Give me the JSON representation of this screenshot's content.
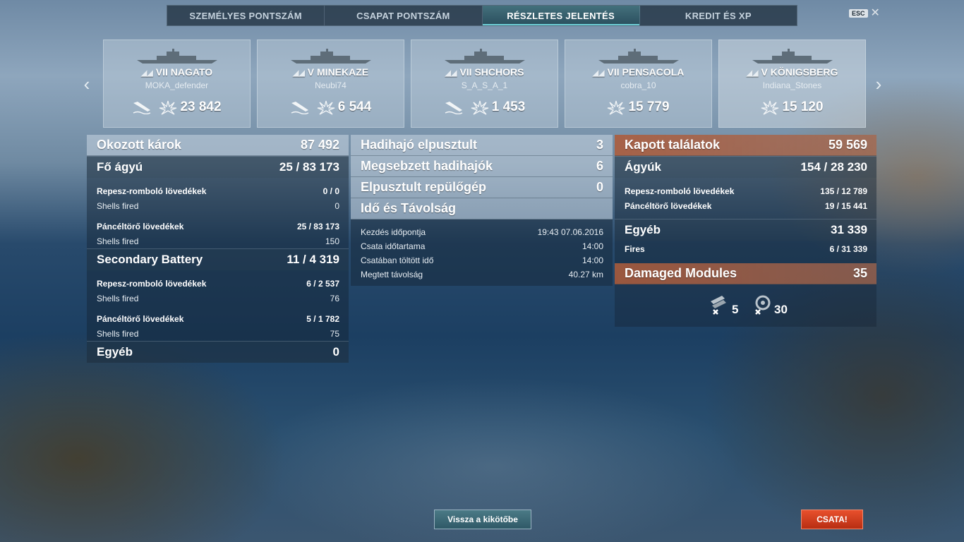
{
  "tabs": [
    "SZEMÉLYES PONTSZÁM",
    "CSAPAT PONTSZÁM",
    "RÉSZLETES JELENTÉS",
    "KREDIT ÉS XP"
  ],
  "active_tab": 2,
  "esc": {
    "key": "ESC",
    "close": "✕"
  },
  "carousel": {
    "prev": "‹",
    "next": "›"
  },
  "ships": [
    {
      "tier": "VII",
      "name": "NAGATO",
      "player": "MOKA_defender",
      "sunk": true,
      "damage": "23 842"
    },
    {
      "tier": "V",
      "name": "MINEKAZE",
      "player": "Neubi74",
      "sunk": true,
      "damage": "6 544"
    },
    {
      "tier": "VII",
      "name": "SHCHORS",
      "player": "S_A_S_A_1",
      "sunk": true,
      "damage": "1 453"
    },
    {
      "tier": "VII",
      "name": "PENSACOLA",
      "player": "cobra_10",
      "sunk": false,
      "damage": "15 779"
    },
    {
      "tier": "V",
      "name": "KÖNIGSBERG",
      "player": "Indiana_Stones",
      "sunk": false,
      "damage": "15 120"
    }
  ],
  "dealt": {
    "header": {
      "label": "Okozott károk",
      "value": "87 492"
    },
    "main": {
      "label": "Fő ágyú",
      "value": "25 / 83 173"
    },
    "main_he": {
      "label": "Repesz-romboló lövedékek",
      "value": "0 / 0"
    },
    "main_he_fired": {
      "label": "Shells fired",
      "value": "0"
    },
    "main_ap": {
      "label": "Páncéltörő lövedékek",
      "value": "25 / 83 173"
    },
    "main_ap_fired": {
      "label": "Shells fired",
      "value": "150"
    },
    "secondary": {
      "label": "Secondary Battery",
      "value": "11 / 4 319"
    },
    "sec_he": {
      "label": "Repesz-romboló lövedékek",
      "value": "6 / 2 537"
    },
    "sec_he_fired": {
      "label": "Shells fired",
      "value": "76"
    },
    "sec_ap": {
      "label": "Páncéltörő lövedékek",
      "value": "5 / 1 782"
    },
    "sec_ap_fired": {
      "label": "Shells fired",
      "value": "75"
    },
    "other": {
      "label": "Egyéb",
      "value": "0"
    }
  },
  "kills": {
    "destroyed": {
      "label": "Hadihajó elpusztult",
      "value": "3"
    },
    "damaged": {
      "label": "Megsebzett hadihajók",
      "value": "6"
    },
    "planes": {
      "label": "Elpusztult repülőgép",
      "value": "0"
    },
    "time_header": {
      "label": "Idő és Távolság"
    },
    "start": {
      "label": "Kezdés időpontja",
      "value": "19:43  07.06.2016"
    },
    "duration": {
      "label": "Csata időtartama",
      "value": "14:00"
    },
    "time_in_battle": {
      "label": "Csatában töltött idő",
      "value": "14:00"
    },
    "distance": {
      "label": "Megtett távolság",
      "value": "40.27 km"
    }
  },
  "received": {
    "header": {
      "label": "Kapott találatok",
      "value": "59 569"
    },
    "guns": {
      "label": "Ágyúk",
      "value": "154 / 28 230"
    },
    "he": {
      "label": "Repesz-romboló lövedékek",
      "value": "135 / 12 789"
    },
    "ap": {
      "label": "Páncéltörő lövedékek",
      "value": "19 / 15 441"
    },
    "other": {
      "label": "Egyéb",
      "value": "31 339"
    },
    "fires": {
      "label": "Fires",
      "value": "6 / 31 339"
    },
    "modules": {
      "label": "Damaged Modules",
      "value": "35"
    },
    "module_counts": {
      "turrets": "5",
      "engine": "30"
    }
  },
  "buttons": {
    "back": "Vissza a kikötőbe",
    "battle": "CSATA!"
  },
  "colors": {
    "accent": "#6fd0d8",
    "received_header": "#b05a37",
    "battle_button": "#e8502d",
    "back_button": "#3f6c79"
  }
}
